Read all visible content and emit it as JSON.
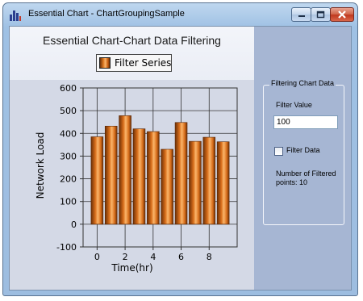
{
  "window": {
    "title": "Essential Chart - ChartGroupingSample",
    "icon": "bar-chart-icon",
    "controls": [
      "minimize",
      "maximize",
      "close"
    ]
  },
  "chart": {
    "title": "Essential Chart-Chart Data Filtering",
    "legend_label": "Filter Series"
  },
  "panel": {
    "group_title": "Filtering Chart Data",
    "filter_value_label": "Filter Value",
    "filter_value": "100",
    "checkbox_label": "Filter Data",
    "checkbox_checked": false,
    "filtered_text": "Number of Filtered points: 10"
  },
  "colors": {
    "bar_dark": "#6b2f06",
    "bar_mid": "#d76d1a",
    "bar_light": "#fbb56a"
  },
  "chart_data": {
    "type": "bar",
    "title": "Essential Chart-Chart Data Filtering",
    "xlabel": "Time(hr)",
    "ylabel": "Network Load",
    "x": [
      0,
      1,
      2,
      3,
      4,
      5,
      6,
      7,
      8,
      9
    ],
    "series": [
      {
        "name": "Filter Series",
        "values": [
          385,
          432,
          478,
          420,
          408,
          330,
          448,
          365,
          383,
          363
        ]
      }
    ],
    "xlim": [
      -1,
      10
    ],
    "ylim": [
      -100,
      600
    ],
    "x_ticks": [
      0,
      2,
      4,
      6,
      8
    ],
    "y_ticks": [
      -100,
      0,
      100,
      200,
      300,
      400,
      500,
      600
    ],
    "grid": true,
    "legend": "top-center"
  }
}
